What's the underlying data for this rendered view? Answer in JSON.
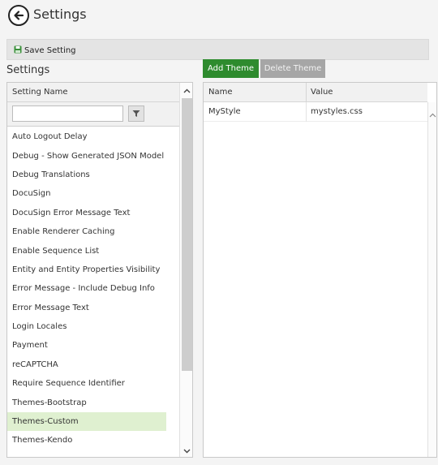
{
  "header": {
    "title": "Settings"
  },
  "toolbar": {
    "save_label": "Save Setting"
  },
  "left": {
    "section_title": "Settings",
    "column_header": "Setting Name",
    "filter_value": "",
    "items": [
      "Auto Logout Delay",
      "Debug - Show Generated JSON Model",
      "Debug Translations",
      "DocuSign",
      "DocuSign Error Message Text",
      "Enable Renderer Caching",
      "Enable Sequence List",
      "Entity and Entity Properties Visibility",
      "Error Message - Include Debug Info",
      "Error Message Text",
      "Login Locales",
      "Payment",
      "reCAPTCHA",
      "Require Sequence Identifier",
      "Themes-Bootstrap",
      "Themes-Custom",
      "Themes-Kendo"
    ],
    "selected_index": 15
  },
  "actions": {
    "add_label": "Add Theme",
    "delete_label": "Delete Theme"
  },
  "right": {
    "columns": [
      "Name",
      "Value"
    ],
    "rows": [
      {
        "name": "MyStyle",
        "value": "mystyles.css"
      }
    ]
  },
  "colors": {
    "accent_green": "#2e8b2e",
    "selected_row": "#dff0d0",
    "disabled_button": "#a6a6a6"
  },
  "icons": {
    "back": "back-arrow-circle-icon",
    "save": "floppy-disk-icon",
    "filter": "funnel-icon",
    "scroll_up": "chevron-up-icon",
    "scroll_down": "chevron-down-icon"
  }
}
